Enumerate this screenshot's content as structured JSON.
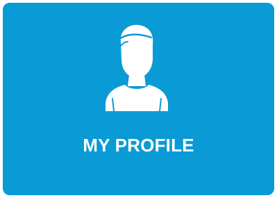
{
  "tile": {
    "label": "MY PROFILE",
    "icon": "user-icon",
    "background_color": "#0a9ad6",
    "foreground_color": "#ffffff"
  }
}
